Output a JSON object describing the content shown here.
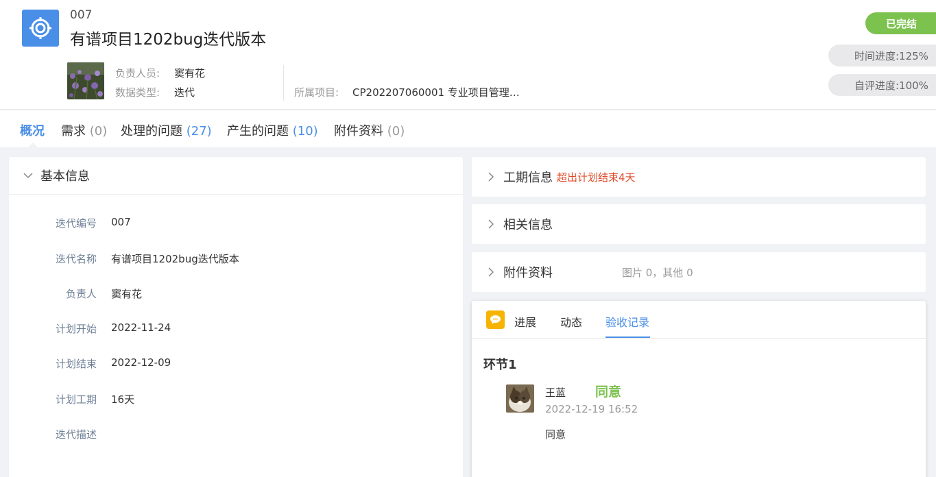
{
  "header": {
    "code": "007",
    "title": "有谱项目1202bug迭代版本",
    "owner_label": "负责人员:",
    "owner_value": "窦有花",
    "type_label": "数据类型:",
    "type_value": "迭代",
    "project_label": "所属项目:",
    "project_value": "CP202207060001 专业项目管理…",
    "status": "已完结",
    "time_progress": "时间进度:125%",
    "self_progress": "自评进度:100%",
    "colors": {
      "accent": "#4a8fe7",
      "success": "#7cc24f",
      "warning": "#e04a2a"
    }
  },
  "tabs": [
    {
      "label": "概况",
      "count": ""
    },
    {
      "label": "需求",
      "count": "(0)"
    },
    {
      "label": "处理的问题",
      "count": "(27)"
    },
    {
      "label": "产生的问题",
      "count": "(10)"
    },
    {
      "label": "附件资料",
      "count": "(0)"
    }
  ],
  "basic_info": {
    "title": "基本信息",
    "fields": [
      {
        "label": "迭代编号",
        "value": "007"
      },
      {
        "label": "迭代名称",
        "value": "有谱项目1202bug迭代版本"
      },
      {
        "label": "负责人",
        "value": "窦有花"
      },
      {
        "label": "计划开始",
        "value": "2022-11-24"
      },
      {
        "label": "计划结束",
        "value": "2022-12-09"
      },
      {
        "label": "计划工期",
        "value": "16天"
      },
      {
        "label": "迭代描述",
        "value": ""
      }
    ]
  },
  "right_sections": {
    "schedule_title": "工期信息",
    "schedule_warning": "超出计划结束4天",
    "related_title": "相关信息",
    "attachments_title": "附件资料",
    "attachments_summary": "图片 0，其他 0"
  },
  "panel": {
    "tabs": [
      "进展",
      "动态",
      "验收记录"
    ],
    "active_tab": "验收记录",
    "stage": "环节1",
    "record": {
      "name": "王蓝",
      "result": "同意",
      "time": "2022-12-19 16:52",
      "comment": "同意"
    }
  }
}
